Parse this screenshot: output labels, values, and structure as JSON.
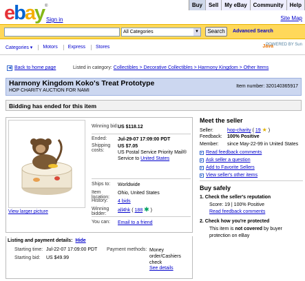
{
  "header": {
    "logo_letters": [
      "e",
      "b",
      "a",
      "y"
    ],
    "logo_tm": "®",
    "signin": "Sign in",
    "topnav": [
      "Buy",
      "Sell",
      "My eBay",
      "Community",
      "Help"
    ],
    "sitemap": "Site Map"
  },
  "search": {
    "query": "",
    "category": "All Categories",
    "button": "Search",
    "advanced": "Advanced Search"
  },
  "catnav": {
    "items": [
      "Categories ▾",
      "Motors",
      "Express",
      "Stores"
    ],
    "java": "Java",
    "sun": "POWERED BY Sun"
  },
  "back": {
    "label": "Back to home page",
    "listed_in": "Listed in category:",
    "crumbs": "Collectibles > Decorative Collectibles > Harmony Kingdom > Other Items"
  },
  "item": {
    "title": "Harmony Kingdom Koko's Treat Prototype",
    "subtitle": "HOP CHARITY AUCTION FOR NAMI",
    "item_number": "Item number: 320140365917",
    "status": "Bidding has ended for this item",
    "view_larger": "View larger picture"
  },
  "details": {
    "winning_bid_label": "Winning bid:",
    "winning_bid": "US $118.12",
    "ended_label": "Ended:",
    "ended": "Jul-29-07 17:09:00 PDT",
    "shipping_label": "Shipping costs:",
    "shipping_price": "US $7.05",
    "shipping_method": "US Postal Service Priority Mail®",
    "shipping_service_to": "Service to ",
    "shipping_dest": "United States",
    "ships_to_label": "Ships to:",
    "ships_to": "Worldwide",
    "location_label": "Item location:",
    "location": "Ohio, United States",
    "history_label": "History:",
    "history": "4 bids",
    "winner_label": "Winning bidder:",
    "winner": "all4hk",
    "winner_score_open": " ( ",
    "winner_score": "188",
    "winner_score_close": " )",
    "you_can_label": "You can:",
    "you_can": "Email to a friend"
  },
  "listing": {
    "header": "Listing and payment details:",
    "hide": "Hide",
    "start_label": "Starting time:",
    "start": "Jul-22-07 17:09:00 PDT",
    "startbid_label": "Starting bid:",
    "startbid": "US $49.99",
    "payment_label": "Payment methods:",
    "payment": "Money order/Cashiers check",
    "payment_link": "See details"
  },
  "seller": {
    "heading": "Meet the seller",
    "seller_label": "Seller:",
    "seller_name": "hop-charity",
    "seller_score_open": " ( ",
    "seller_score": "19",
    "seller_score_close": " )",
    "feedback_label": "Feedback:",
    "feedback": "100% Positive",
    "member_label": "Member:",
    "member": "since May-22-99 in United States",
    "links": [
      "Read feedback comments",
      "Ask seller a question",
      "Add to Favorite Sellers",
      "View seller's other items"
    ]
  },
  "buysafe": {
    "heading": "Buy safely",
    "step1": "1.  Check the seller's reputation",
    "step1_detail": "Score: 19 | 100% Positive",
    "step1_link": "Read feedback comments",
    "step2": "2.  Check how you're protected",
    "step2_detail_a": "This item is ",
    "step2_detail_b": "not covered",
    "step2_detail_c": " by buyer",
    "step2_detail_d": "protection on eBay"
  },
  "colors": {
    "title_bg": "#ccd7f0",
    "search_bar": "#ffd85a",
    "link": "#0000cc"
  }
}
